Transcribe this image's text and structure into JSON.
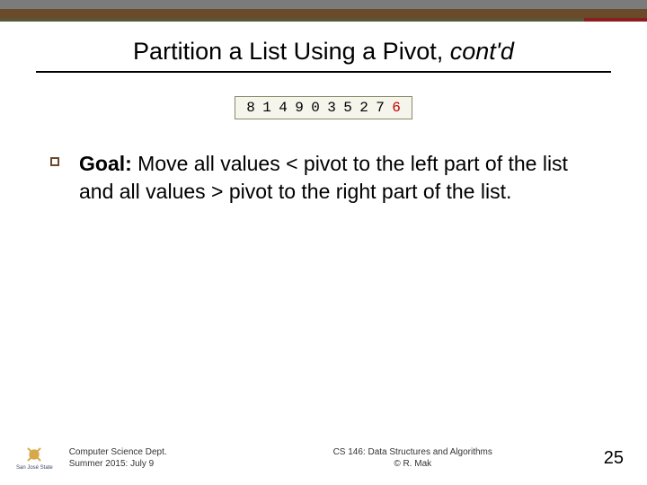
{
  "title_main": "Partition a List Using a Pivot, ",
  "title_italic": "cont'd",
  "array": [
    "8",
    "1",
    "4",
    "9",
    "0",
    "3",
    "5",
    "2",
    "7",
    "6"
  ],
  "pivot_index": 9,
  "goal_label": "Goal:",
  "goal_text_1": " Move all values < pivot to the left part of the list and all values > pivot to the right part of the list.",
  "footer": {
    "dept_line1": "Computer Science Dept.",
    "dept_line2": "Summer 2015: July 9",
    "course_line1": "CS 146: Data Structures and Algorithms",
    "course_line2": "© R. Mak",
    "logo_text": "San José State"
  },
  "page_number": "25"
}
